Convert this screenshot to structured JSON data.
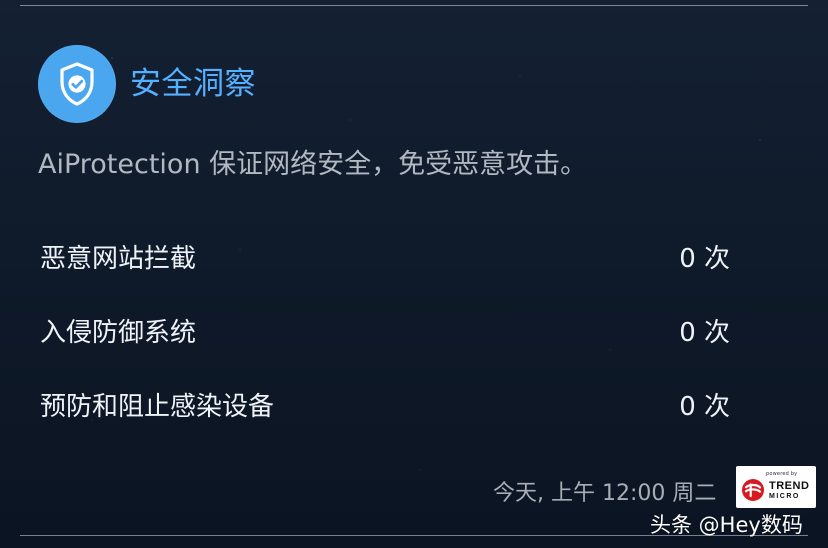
{
  "header": {
    "title": "安全洞察",
    "icon": "shield-check-icon"
  },
  "subtitle": "AiProtection 保证网络安全，免受恶意攻击。",
  "stats": [
    {
      "label": "恶意网站拦截",
      "value": "0 次"
    },
    {
      "label": "入侵防御系统",
      "value": "0 次"
    },
    {
      "label": "预防和阻止感染设备",
      "value": "0 次"
    }
  ],
  "footer": {
    "timestamp": "今天, 上午 12:00 周二",
    "brand": {
      "powered_by": "powered by",
      "trend": "TREND",
      "micro": "MICRO"
    },
    "watermark": "头条 @Hey数码"
  },
  "colors": {
    "accent": "#55b1ff",
    "badge": "#4aa7ef",
    "background": "#0f1a2a",
    "text": "#eef3f8",
    "muted": "#b2b8c1",
    "trend_red": "#d71920"
  }
}
